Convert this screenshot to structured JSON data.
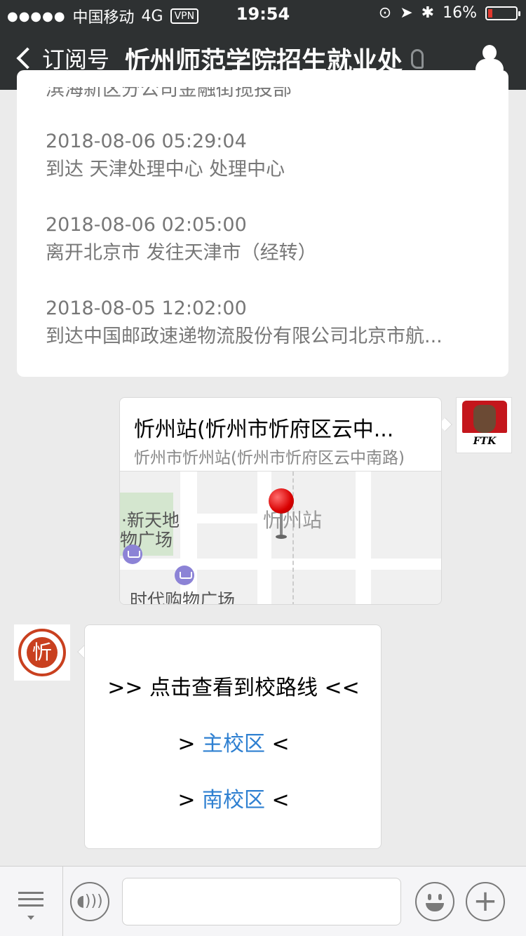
{
  "status_bar": {
    "carrier": "中国移动",
    "network": "4G",
    "vpn": "VPN",
    "time": "19:54",
    "battery": "16%",
    "battery_level": 0.16
  },
  "nav": {
    "back_label": "订阅号",
    "title": "忻州师范学院招生就业处"
  },
  "tracking": {
    "partial_line": "滨海新区分公司金融街揽投部",
    "entries": [
      {
        "time": "2018-08-06 05:29:04",
        "desc": "到达  天津处理中心 处理中心"
      },
      {
        "time": "2018-08-06 02:05:00",
        "desc": "离开北京市 发往天津市（经转）"
      },
      {
        "time": "2018-08-05 12:02:00",
        "desc": "到达中国邮政速递物流股份有限公司北京市航..."
      }
    ]
  },
  "location_message": {
    "title": "忻州站(忻州市忻府区云中...",
    "subtitle": "忻州市忻州站(忻州市忻府区云中南路)",
    "map_labels": {
      "park_line1": "·新天地",
      "park_line2": "物广场",
      "station": "忻州站",
      "mall": "时代购物广场"
    }
  },
  "avatars": {
    "ftk_text": "FTK",
    "uni_glyph": "忻"
  },
  "route_message": {
    "heading": ">> 点击查看到校路线 <<",
    "links": [
      {
        "prefix": ">",
        "label": "主校区",
        "suffix": "<"
      },
      {
        "prefix": ">",
        "label": "南校区",
        "suffix": "<"
      }
    ]
  },
  "toolbar": {
    "input_placeholder": ""
  },
  "colors": {
    "nav_bg": "#2e3132",
    "chat_bg": "#ebebeb",
    "link": "#2f80d1",
    "battery_low": "#e0382e"
  }
}
